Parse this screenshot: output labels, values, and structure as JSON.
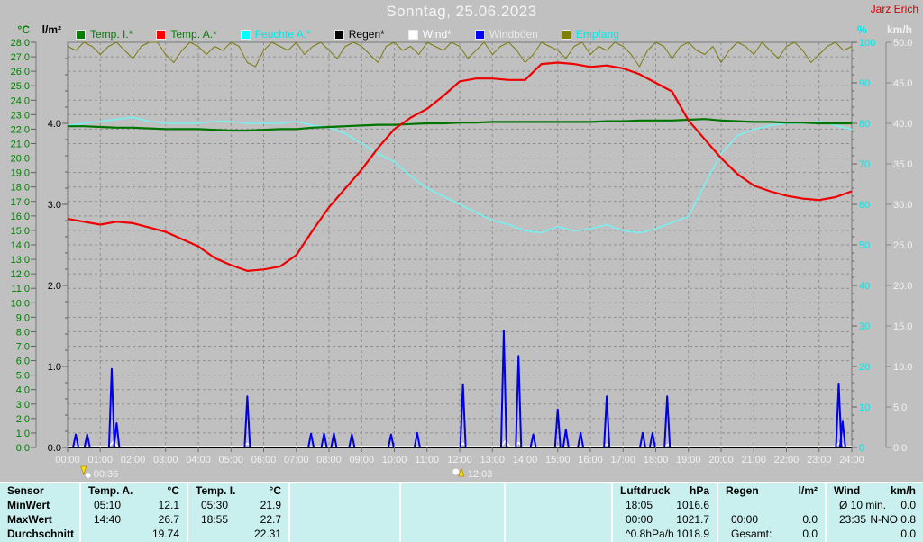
{
  "window": {
    "title": "Sonntag, 25.06.2023",
    "user": "Jarz Erich"
  },
  "axis_units": {
    "temp": "°C",
    "rain": "l/m²",
    "humidity": "%",
    "wind": "km/h"
  },
  "legend": [
    {
      "label": "Temp. I.*",
      "swatch": "#008000",
      "text_color": "#008000"
    },
    {
      "label": "Temp. A.*",
      "swatch": "#ff0000",
      "text_color": "#008000"
    },
    {
      "label": "Feuchte A.*",
      "swatch": "#00ffff",
      "text_color": "#00e8e8"
    },
    {
      "label": "Regen*",
      "swatch": "#000000",
      "text_color": "#000000"
    },
    {
      "label": "Wind*",
      "swatch": "#ffffff",
      "text_color": "#ffffff"
    },
    {
      "label": "Windböen",
      "swatch": "#0000ff",
      "text_color": "#e8e8e8"
    },
    {
      "label": "Empfang",
      "swatch": "#808000",
      "text_color": "#00e8e8"
    }
  ],
  "chart_data": {
    "type": "line",
    "title": "Sonntag, 25.06.2023",
    "grid": "dashed, 1 °C horizontal steps, hourly vertical steps",
    "axes": {
      "temp_c": {
        "min": 0,
        "max": 28,
        "step": 1,
        "decimals": 1,
        "side": "left",
        "label_color": "#008000"
      },
      "rain_lm2": {
        "min": 0,
        "max": 5,
        "step": 1,
        "decimals": 1,
        "side": "left",
        "label_color": "#000000"
      },
      "humidity_pct": {
        "min": 0,
        "max": 100,
        "step": 10,
        "decimals": 0,
        "side": "right",
        "label_color": "#00e8e8"
      },
      "wind_kmh": {
        "min": 0,
        "max": 50,
        "step": 5,
        "decimals": 1,
        "side": "right",
        "label_color": "#f2f2f2"
      }
    },
    "x_hours": {
      "min": 0,
      "max": 24,
      "tick_labels": [
        "00:00",
        "01:00",
        "02:00",
        "03:00",
        "04:00",
        "05:00",
        "06:00",
        "07:00",
        "08:00",
        "09:00",
        "10:00",
        "11:00",
        "12:00",
        "13:00",
        "14:00",
        "15:00",
        "16:00",
        "17:00",
        "18:00",
        "19:00",
        "20:00",
        "21:00",
        "22:00",
        "23:00",
        "24:00"
      ]
    },
    "sun_markers": [
      {
        "time": "00:36",
        "hour": 0.6,
        "icon": "moon-down-icon"
      },
      {
        "time": "12:03",
        "hour": 12.05,
        "icon": "moon-up-icon"
      }
    ],
    "series": [
      {
        "name": "Empfang",
        "unit": "%",
        "color": "#7b7b10",
        "width": 1,
        "scale_max": 100,
        "x_start": 0,
        "x_step": 0.25,
        "values": [
          99,
          98,
          100,
          99,
          97,
          99,
          100,
          98,
          96,
          99,
          100,
          100,
          97,
          95,
          98,
          100,
          99,
          97,
          99,
          98,
          100,
          99,
          95,
          94,
          98,
          100,
          99,
          98,
          100,
          97,
          99,
          100,
          98,
          96,
          99,
          100,
          99,
          97,
          95,
          99,
          100,
          98,
          99,
          97,
          100,
          99,
          98,
          100,
          99,
          96,
          98,
          100,
          97,
          99,
          100,
          98,
          95,
          97,
          100,
          99,
          98,
          96,
          99,
          100,
          97,
          99,
          98,
          100,
          99,
          97,
          94,
          98,
          100,
          99,
          96,
          99,
          100,
          98,
          97,
          99,
          95,
          98,
          100,
          99,
          97,
          100,
          98,
          96,
          99,
          100,
          98,
          95,
          97,
          99,
          100,
          98,
          99
        ]
      },
      {
        "name": "Feuchte A.*",
        "unit": "%",
        "color": "#79f0f0",
        "width": 1.6,
        "scale_max": 100,
        "x_start": 0,
        "x_step": 0.5,
        "values": [
          79.5,
          80,
          80.5,
          81,
          81.5,
          80.5,
          80,
          80,
          80,
          80.5,
          80.5,
          80,
          80,
          80,
          80.5,
          79.5,
          79,
          77.5,
          75,
          72.5,
          70.5,
          67,
          64,
          62,
          60,
          58,
          56,
          55,
          53.5,
          53,
          54.5,
          53.5,
          54,
          55,
          53.5,
          53,
          54,
          55.5,
          57,
          65,
          72.5,
          77,
          78.5,
          79.5,
          80,
          80,
          80.5,
          79.5,
          78.5
        ],
        "note_last_value": 77.5
      },
      {
        "name": "Temp. I.*",
        "unit": "°C",
        "color": "#007400",
        "width": 2.2,
        "scale_max": 28,
        "x_start": 0,
        "x_step": 0.5,
        "values": [
          22.2,
          22.2,
          22.15,
          22.1,
          22.1,
          22.05,
          22.0,
          22.0,
          22.0,
          21.95,
          21.9,
          21.9,
          21.95,
          22.0,
          22.0,
          22.1,
          22.15,
          22.2,
          22.25,
          22.3,
          22.3,
          22.35,
          22.4,
          22.4,
          22.45,
          22.45,
          22.5,
          22.5,
          22.5,
          22.5,
          22.5,
          22.5,
          22.5,
          22.55,
          22.55,
          22.6,
          22.6,
          22.6,
          22.65,
          22.7,
          22.6,
          22.55,
          22.5,
          22.5,
          22.45,
          22.45,
          22.4,
          22.4,
          22.4
        ]
      },
      {
        "name": "Temp. A.*",
        "unit": "°C",
        "color": "#ee0000",
        "width": 2.2,
        "scale_max": 28,
        "x_start": 0,
        "x_step": 0.5,
        "values": [
          15.8,
          15.6,
          15.4,
          15.6,
          15.5,
          15.2,
          14.9,
          14.4,
          13.9,
          13.1,
          12.6,
          12.2,
          12.3,
          12.5,
          13.3,
          15.0,
          16.6,
          17.9,
          19.2,
          20.7,
          22.0,
          22.8,
          23.4,
          24.3,
          25.3,
          25.5,
          25.5,
          25.4,
          25.4,
          26.5,
          26.6,
          26.5,
          26.3,
          26.4,
          26.2,
          25.8,
          25.2,
          24.6,
          22.6,
          21.3,
          20.0,
          18.9,
          18.1,
          17.7,
          17.4,
          17.2,
          17.1,
          17.3,
          17.7
        ]
      },
      {
        "name": "Regen*",
        "unit": "l/m²",
        "color": "#000000",
        "width": 1,
        "scale_max": 5,
        "x_start": 0,
        "x_step": 0.5,
        "all_zero": true,
        "values": []
      }
    ],
    "wind_bumps": {
      "name": "Wind*",
      "unit": "km/h",
      "color": "#ffffff",
      "scale_max": 50,
      "spikes": [
        [
          1.4,
          0.7
        ],
        [
          5.5,
          0.5
        ],
        [
          12.1,
          0.5
        ],
        [
          13.4,
          0.8
        ],
        [
          13.8,
          0.6
        ],
        [
          16.5,
          0.4
        ],
        [
          18.4,
          0.4
        ],
        [
          23.65,
          0.7
        ]
      ]
    },
    "gusts": {
      "name": "Windböen",
      "unit": "km/h",
      "color": "#0000e8",
      "scale_max": 50,
      "spikes": [
        [
          0.25,
          1.6
        ],
        [
          0.6,
          1.6
        ],
        [
          1.35,
          9.7
        ],
        [
          1.5,
          3.0
        ],
        [
          5.5,
          6.3
        ],
        [
          7.45,
          1.7
        ],
        [
          7.85,
          1.7
        ],
        [
          8.15,
          1.7
        ],
        [
          8.7,
          1.6
        ],
        [
          9.9,
          1.6
        ],
        [
          10.7,
          1.8
        ],
        [
          12.1,
          7.8
        ],
        [
          13.35,
          14.4
        ],
        [
          13.8,
          11.3
        ],
        [
          14.25,
          1.6
        ],
        [
          15.0,
          4.7
        ],
        [
          15.25,
          2.2
        ],
        [
          15.7,
          1.8
        ],
        [
          16.5,
          6.3
        ],
        [
          17.6,
          1.8
        ],
        [
          17.9,
          1.8
        ],
        [
          18.35,
          6.3
        ],
        [
          23.6,
          7.9
        ],
        [
          23.72,
          3.2
        ]
      ]
    }
  },
  "table": {
    "row_labels": [
      "Sensor",
      "MinWert",
      "MaxWert",
      "Durchschnitt"
    ],
    "columns": [
      {
        "name": "Temp. A.",
        "unit": "°C",
        "min": [
          "05:10",
          "12.1"
        ],
        "max": [
          "14:40",
          "26.7"
        ],
        "avg": [
          "",
          "19.74"
        ]
      },
      {
        "name": "Temp. I.",
        "unit": "°C",
        "min": [
          "05:30",
          "21.9"
        ],
        "max": [
          "18:55",
          "22.7"
        ],
        "avg": [
          "",
          "22.31"
        ]
      },
      {
        "name": "",
        "unit": "",
        "min": [
          "",
          ""
        ],
        "max": [
          "",
          ""
        ],
        "avg": [
          "",
          ""
        ]
      },
      {
        "name": "",
        "unit": "",
        "min": [
          "",
          ""
        ],
        "max": [
          "",
          ""
        ],
        "avg": [
          "",
          ""
        ]
      },
      {
        "name": "",
        "unit": "",
        "min": [
          "",
          ""
        ],
        "max": [
          "",
          ""
        ],
        "avg": [
          "",
          ""
        ]
      },
      {
        "name": "Luftdruck",
        "unit": "hPa",
        "min": [
          "18:05",
          "1016.6"
        ],
        "max": [
          "00:00",
          "1021.7"
        ],
        "avg": [
          "^0.8hPa/h",
          "1018.9"
        ]
      },
      {
        "name": "Regen",
        "unit": "l/m²",
        "min": [
          "",
          ""
        ],
        "max": [
          "00:00",
          "0.0"
        ],
        "avg": [
          "Gesamt:",
          "0.0"
        ]
      },
      {
        "name": "Wind",
        "unit": "km/h",
        "min": [
          "Ø 10 min.",
          "0.0"
        ],
        "max": [
          "23:35",
          "N-NO 0.8"
        ],
        "avg": [
          "",
          "0.0"
        ]
      }
    ]
  }
}
